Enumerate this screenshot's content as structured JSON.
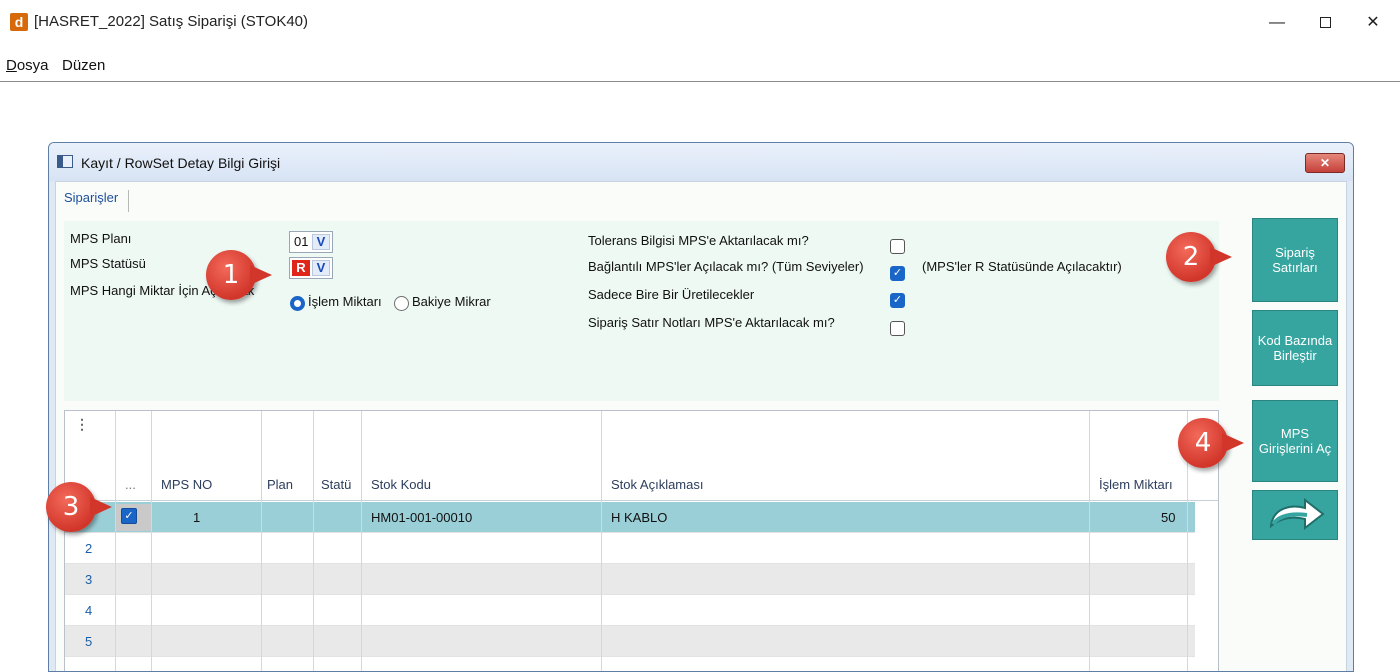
{
  "app": {
    "logo": "d",
    "title": "[HASRET_2022] Satış Siparişi (STOK40)",
    "minimize": "—",
    "close": "✕"
  },
  "menu": {
    "dosya_first": "D",
    "dosya_rest": "osya",
    "duzen": "Düzen"
  },
  "dialog": {
    "title": "Kayıt / RowSet Detay Bilgi Girişi",
    "close": "✕",
    "tab": "Siparişler"
  },
  "form": {
    "mps_plani_label": "MPS Planı",
    "mps_plani_value": "01",
    "mps_statusu_label": "MPS Statüsü",
    "mps_statusu_value": "R",
    "combo_arrow": "V",
    "miktar_label": "MPS Hangi Miktar İçin Açıkacak",
    "radio_islem": "İşlem Miktarı",
    "radio_bakiye": "Bakiye Mikrar",
    "tolerans_label": "Tolerans Bilgisi MPS'e Aktarılacak mı?",
    "baglantili_label": "Bağlantılı MPS'ler Açılacak mı? (Tüm Seviyeler)",
    "baglantili_note": "(MPS'ler R Statüsünde Açılacaktır)",
    "sadece_label": "Sadece Bire Bir Üretilecekler",
    "notlar_label": "Sipariş Satır Notları MPS'e Aktarılacak mı?",
    "checked_glyph": "✓"
  },
  "side_buttons": {
    "siparis": "Sipariş Satırları",
    "kod": "Kod Bazında Birleştir",
    "mps": "MPS Girişlerini Aç"
  },
  "grid": {
    "menu_dots": "⋮",
    "headers": [
      "...",
      "MPS NO",
      "Plan",
      "Statü",
      "Stok Kodu",
      "Stok Açıklaması",
      "İşlem Miktarı"
    ],
    "rows": [
      {
        "num": "",
        "mps_no": "1",
        "plan": "",
        "statu": "",
        "stok_kodu": "HM01-001-00010",
        "stok_aciklamasi": "H KABLO",
        "islem_miktari": "50"
      },
      {
        "num": "2"
      },
      {
        "num": "3"
      },
      {
        "num": "4"
      },
      {
        "num": "5"
      }
    ]
  },
  "callouts": [
    "1",
    "2",
    "3",
    "4"
  ],
  "colors": {
    "accent_teal": "#36a5a0",
    "selected_row": "#9bcfd7",
    "callout_red": "#d2362b",
    "panel_bg": "#eef9f4"
  }
}
